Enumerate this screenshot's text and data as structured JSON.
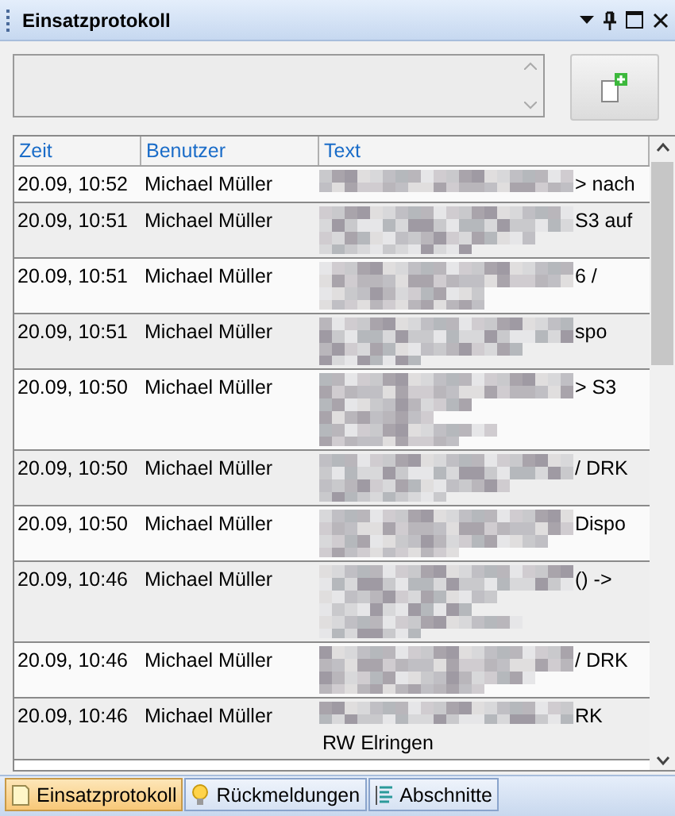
{
  "window": {
    "title": "Einsatzprotokoll"
  },
  "table": {
    "columns": [
      "Zeit",
      "Benutzer",
      "Text"
    ],
    "rows": [
      {
        "time": "20.09, 10:52",
        "user": "Michael Müller",
        "text_tail": "> nach"
      },
      {
        "time": "20.09, 10:51",
        "user": "Michael Müller",
        "text_tail": "S3 auf"
      },
      {
        "time": "20.09, 10:51",
        "user": "Michael Müller",
        "text_tail": "6 /"
      },
      {
        "time": "20.09, 10:51",
        "user": "Michael Müller",
        "text_tail": "spo"
      },
      {
        "time": "20.09, 10:50",
        "user": "Michael Müller",
        "text_tail": "> S3"
      },
      {
        "time": "20.09, 10:50",
        "user": "Michael Müller",
        "text_tail": "/ DRK"
      },
      {
        "time": "20.09, 10:50",
        "user": "Michael Müller",
        "text_tail": "Dispo"
      },
      {
        "time": "20.09, 10:46",
        "user": "Michael Müller",
        "text_tail": "() ->"
      },
      {
        "time": "20.09, 10:46",
        "user": "Michael Müller",
        "text_tail": "/ DRK"
      },
      {
        "time": "20.09, 10:46",
        "user": "Michael Müller",
        "text_tail": "RK",
        "text_next_line": "RW Elringen"
      }
    ]
  },
  "bottom_tabs": [
    {
      "label": "Einsatzprotokoll",
      "kind": "note",
      "selected": true
    },
    {
      "label": "Rückmeldungen",
      "kind": "bulb",
      "selected": false
    },
    {
      "label": "Abschnitte",
      "kind": "list",
      "selected": false
    }
  ]
}
